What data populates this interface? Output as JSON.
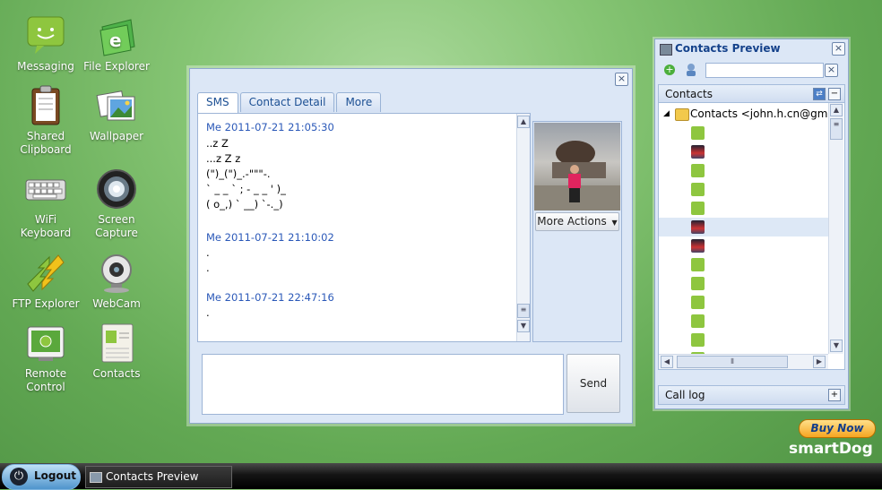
{
  "desktop": {
    "icons": [
      {
        "label": "Messaging",
        "icon": "messaging-icon"
      },
      {
        "label": "File Explorer",
        "icon": "file-explorer-icon"
      },
      {
        "label": "Shared\nClipboard",
        "icon": "clipboard-icon"
      },
      {
        "label": "Wallpaper",
        "icon": "wallpaper-icon"
      },
      {
        "label": "WiFi\nKeyboard",
        "icon": "keyboard-icon"
      },
      {
        "label": "Screen\nCapture",
        "icon": "camera-lens-icon"
      },
      {
        "label": "FTP Explorer",
        "icon": "ftp-icon"
      },
      {
        "label": "WebCam",
        "icon": "webcam-icon"
      },
      {
        "label": "Remote\nControl",
        "icon": "remote-control-icon"
      },
      {
        "label": "Contacts",
        "icon": "contacts-icon"
      }
    ]
  },
  "sms_window": {
    "title": "",
    "tabs": [
      "SMS",
      "Contact Detail",
      "More"
    ],
    "active_tab": "SMS",
    "messages": [
      {
        "header": "Me 2011-07-21 21:05:30",
        "lines": [
          "..z Z",
          "...z Z z",
          "(\")_(\")_.-\"\"\"-.",
          "` _ _ ` ; - _ _ ' )_",
          "( o_,) ` __) `-._)"
        ]
      },
      {
        "header": "Me 2011-07-21 21:10:02",
        "lines": [
          ".",
          "."
        ]
      },
      {
        "header": "Me 2011-07-21 22:47:16",
        "lines": [
          "."
        ]
      }
    ],
    "more_actions_label": "More Actions",
    "compose_value": "",
    "send_label": "Send"
  },
  "contacts_preview": {
    "title": "Contacts Preview",
    "search_value": "",
    "section_label": "Contacts",
    "root_node": "Contacts <john.h.cn@gmail",
    "contacts": [
      {
        "name": "",
        "avatar": "green"
      },
      {
        "name": "",
        "avatar": "photo"
      },
      {
        "name": "",
        "avatar": "green"
      },
      {
        "name": "",
        "avatar": "green"
      },
      {
        "name": "",
        "avatar": "green"
      },
      {
        "name": "",
        "avatar": "photo"
      },
      {
        "name": "",
        "avatar": "photo"
      },
      {
        "name": "",
        "avatar": "green"
      },
      {
        "name": "",
        "avatar": "green"
      },
      {
        "name": "",
        "avatar": "green"
      },
      {
        "name": "",
        "avatar": "green"
      },
      {
        "name": "",
        "avatar": "green"
      },
      {
        "name": "",
        "avatar": "green"
      }
    ],
    "selected_index": 5,
    "call_log_label": "Call log"
  },
  "promo": {
    "buy_now_label": "Buy Now",
    "brand": "smartDog"
  },
  "taskbar": {
    "logout_label": "Logout",
    "task_label": "Contacts Preview"
  },
  "colors": {
    "accent": "#15428b",
    "link_blue": "#2a58b8",
    "selected_row": "#dde8f6",
    "icon_green": "#8ec63f"
  }
}
